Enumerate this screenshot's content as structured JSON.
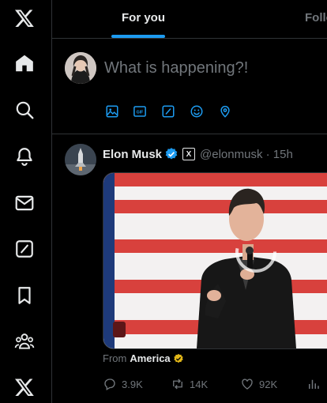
{
  "tabs": [
    {
      "label": "For you",
      "active": true
    },
    {
      "label": "Follo",
      "active": false
    }
  ],
  "composer": {
    "placeholder": "What is happening?!"
  },
  "post": {
    "display_name": "Elon Musk",
    "affiliation_badge": "X",
    "handle_time": "@elonmusk · 15h",
    "from_prefix": "From",
    "from_name": "America",
    "replies": "3.9K",
    "reposts": "14K",
    "likes": "92K"
  },
  "colors": {
    "accent": "#1d9bf0",
    "background": "#000000",
    "muted": "#71767b",
    "verified": "#1d9bf0",
    "gold_badge": "#e2b719"
  }
}
